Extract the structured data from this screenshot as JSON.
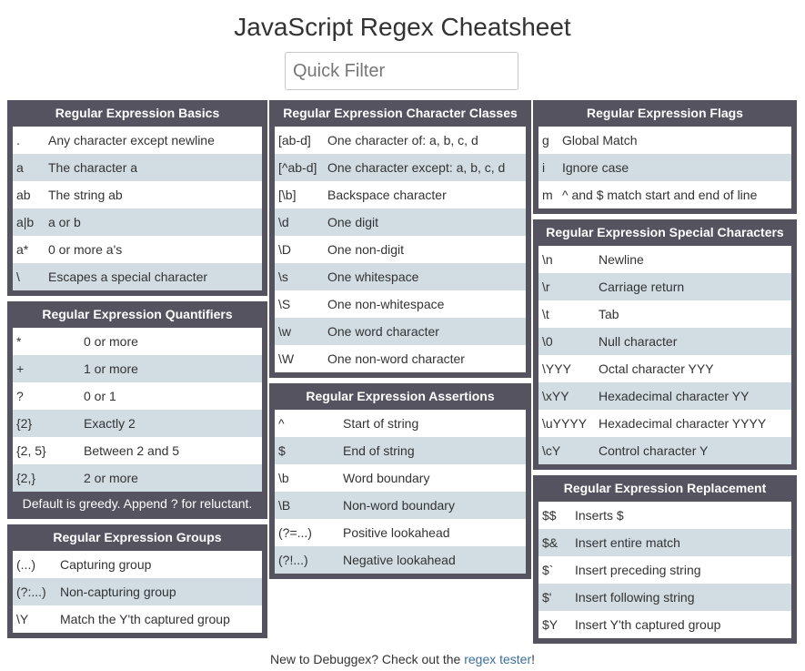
{
  "title": "JavaScript Regex Cheatsheet",
  "filter": {
    "placeholder": "Quick Filter"
  },
  "panels": {
    "basics": {
      "title": "Regular Expression Basics",
      "rows": [
        {
          "k": ".",
          "v": "Any character except newline"
        },
        {
          "k": "a",
          "v": "The character a"
        },
        {
          "k": "ab",
          "v": "The string ab"
        },
        {
          "k": "a|b",
          "v": "a or b"
        },
        {
          "k": "a*",
          "v": "0 or more a's"
        },
        {
          "k": "\\",
          "v": "Escapes a special character"
        }
      ]
    },
    "quantifiers": {
      "title": "Regular Expression Quantifiers",
      "rows": [
        {
          "k": "*",
          "v": "0 or more"
        },
        {
          "k": "+",
          "v": "1 or more"
        },
        {
          "k": "?",
          "v": "0 or 1"
        },
        {
          "k": "{2}",
          "v": "Exactly 2"
        },
        {
          "k": "{2, 5}",
          "v": "Between 2 and 5"
        },
        {
          "k": "{2,}",
          "v": "2 or more"
        }
      ],
      "note": "Default is greedy. Append ? for reluctant."
    },
    "groups": {
      "title": "Regular Expression Groups",
      "rows": [
        {
          "k": "(...)",
          "v": "Capturing group"
        },
        {
          "k": "(?:...)",
          "v": "Non-capturing group"
        },
        {
          "k": "\\Y",
          "v": "Match the Y'th captured group"
        }
      ]
    },
    "classes": {
      "title": "Regular Expression Character Classes",
      "rows": [
        {
          "k": "[ab-d]",
          "v": "One character of: a, b, c, d"
        },
        {
          "k": "[^ab-d]",
          "v": "One character except: a, b, c, d"
        },
        {
          "k": "[\\b]",
          "v": "Backspace character"
        },
        {
          "k": "\\d",
          "v": "One digit"
        },
        {
          "k": "\\D",
          "v": "One non-digit"
        },
        {
          "k": "\\s",
          "v": "One whitespace"
        },
        {
          "k": "\\S",
          "v": "One non-whitespace"
        },
        {
          "k": "\\w",
          "v": "One word character"
        },
        {
          "k": "\\W",
          "v": "One non-word character"
        }
      ]
    },
    "assertions": {
      "title": "Regular Expression Assertions",
      "rows": [
        {
          "k": "^",
          "v": "Start of string"
        },
        {
          "k": "$",
          "v": "End of string"
        },
        {
          "k": "\\b",
          "v": "Word boundary"
        },
        {
          "k": "\\B",
          "v": "Non-word boundary"
        },
        {
          "k": "(?=...)",
          "v": "Positive lookahead"
        },
        {
          "k": "(?!...)",
          "v": "Negative lookahead"
        }
      ]
    },
    "flags": {
      "title": "Regular Expression Flags",
      "rows": [
        {
          "k": "g",
          "v": "Global Match"
        },
        {
          "k": "i",
          "v": "Ignore case"
        },
        {
          "k": "m",
          "v": "^ and $ match start and end of line"
        }
      ]
    },
    "special": {
      "title": "Regular Expression Special Characters",
      "rows": [
        {
          "k": "\\n",
          "v": "Newline"
        },
        {
          "k": "\\r",
          "v": "Carriage return"
        },
        {
          "k": "\\t",
          "v": "Tab"
        },
        {
          "k": "\\0",
          "v": "Null character"
        },
        {
          "k": "\\YYY",
          "v": "Octal character YYY"
        },
        {
          "k": "\\xYY",
          "v": "Hexadecimal character YY"
        },
        {
          "k": "\\uYYYY",
          "v": "Hexadecimal character YYYY"
        },
        {
          "k": "\\cY",
          "v": "Control character Y"
        }
      ]
    },
    "replacement": {
      "title": "Regular Expression Replacement",
      "rows": [
        {
          "k": "$$",
          "v": "Inserts $"
        },
        {
          "k": "$&",
          "v": "Insert entire match"
        },
        {
          "k": "$`",
          "v": "Insert preceding string"
        },
        {
          "k": "$'",
          "v": "Insert following string"
        },
        {
          "k": "$Y",
          "v": "Insert Y'th captured group"
        }
      ]
    }
  },
  "footer": {
    "prefix": "New to Debuggex? Check out the ",
    "link": "regex tester",
    "suffix": "!"
  },
  "colors": {
    "panel_bg": "#555360",
    "row_alt": "#d1dde3",
    "link": "#3a6e9f"
  }
}
